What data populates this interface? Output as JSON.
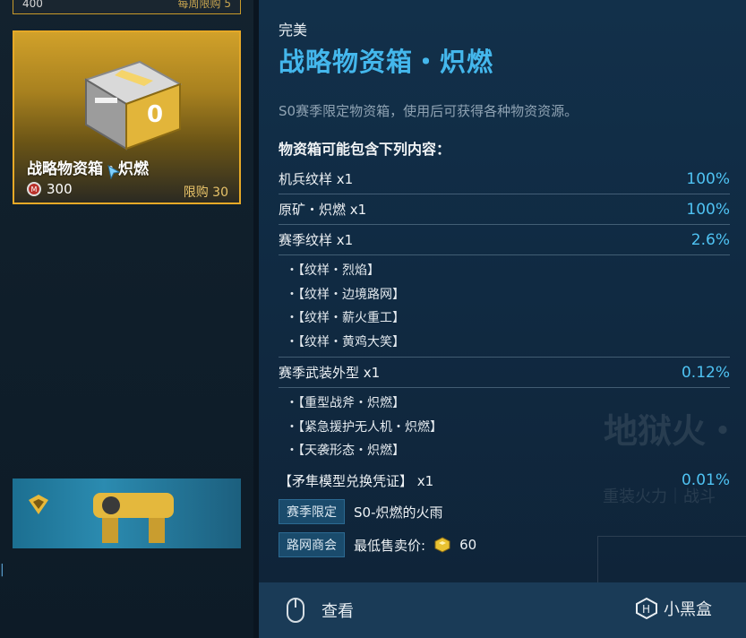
{
  "left": {
    "top_strip": {
      "price": "400",
      "limit": "每周限购 5"
    },
    "card": {
      "title": "战略物资箱・炽燃",
      "price": "300",
      "limit": "限购 30"
    }
  },
  "detail": {
    "rarity": "完美",
    "title": "战略物资箱・炽燃",
    "description": "S0赛季限定物资箱，使用后可获得各种物资资源。",
    "contents_header": "物资箱可能包含下列内容：",
    "rows": [
      {
        "name": "机兵纹样 x1",
        "pct": "100%"
      },
      {
        "name": "原矿・炽燃 x1",
        "pct": "100%"
      },
      {
        "name": "赛季纹样 x1",
        "pct": "2.6%"
      }
    ],
    "season_patterns": [
      "・【纹样・烈焰】",
      "・【纹样・边境路网】",
      "・【纹样・薪火重工】",
      "・【纹样・黄鸡大笑】"
    ],
    "weapon_row": {
      "name": "赛季武装外型 x1",
      "pct": "0.12%"
    },
    "weapon_items": [
      "・【重型战斧・炽燃】",
      "・【紧急援护无人机・炽燃】",
      "・【天袭形态・炽燃】"
    ],
    "voucher_row": {
      "name": "【矛隼模型兑换凭证】 x1",
      "pct": "0.01%"
    },
    "tags": [
      {
        "tag": "赛季限定",
        "text": "S0-炽燃的火雨"
      },
      {
        "tag": "路网商会",
        "text": "最低售卖价:",
        "value": "60"
      }
    ],
    "action": "查看",
    "background_text": {
      "line1": "地狱火・",
      "line2": "重装火力｜战斗"
    }
  },
  "watermark": "小黑盒",
  "colors": {
    "accent": "#44b7ec",
    "gold": "#e6a927"
  }
}
